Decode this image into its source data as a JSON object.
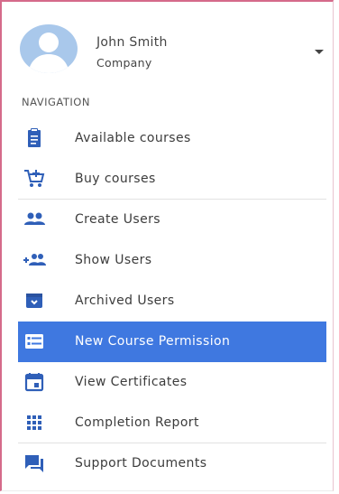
{
  "user": {
    "name": "John Smith",
    "company": "Company",
    "avatar_icon": "user-avatar-icon",
    "menu_icon": "caret-down-icon"
  },
  "navigation": {
    "heading": "NAVIGATION",
    "items": [
      {
        "label": "Available courses",
        "icon": "clipboard-icon",
        "active": false
      },
      {
        "label": "Buy courses",
        "icon": "cart-add-icon",
        "active": false
      },
      {
        "label": "Create Users",
        "icon": "people-icon",
        "active": false
      },
      {
        "label": "Show Users",
        "icon": "group-add-icon",
        "active": false
      },
      {
        "label": "Archived Users",
        "icon": "archive-icon",
        "active": false
      },
      {
        "label": "New Course Permission",
        "icon": "list-card-icon",
        "active": true
      },
      {
        "label": "View Certificates",
        "icon": "calendar-icon",
        "active": false
      },
      {
        "label": "Completion Report",
        "icon": "grid-icon",
        "active": false
      },
      {
        "label": "Support Documents",
        "icon": "chat-icon",
        "active": false
      }
    ]
  },
  "colors": {
    "accent": "#3f78e0",
    "icon": "#2f5fb8",
    "frame": "#d56a8a"
  }
}
